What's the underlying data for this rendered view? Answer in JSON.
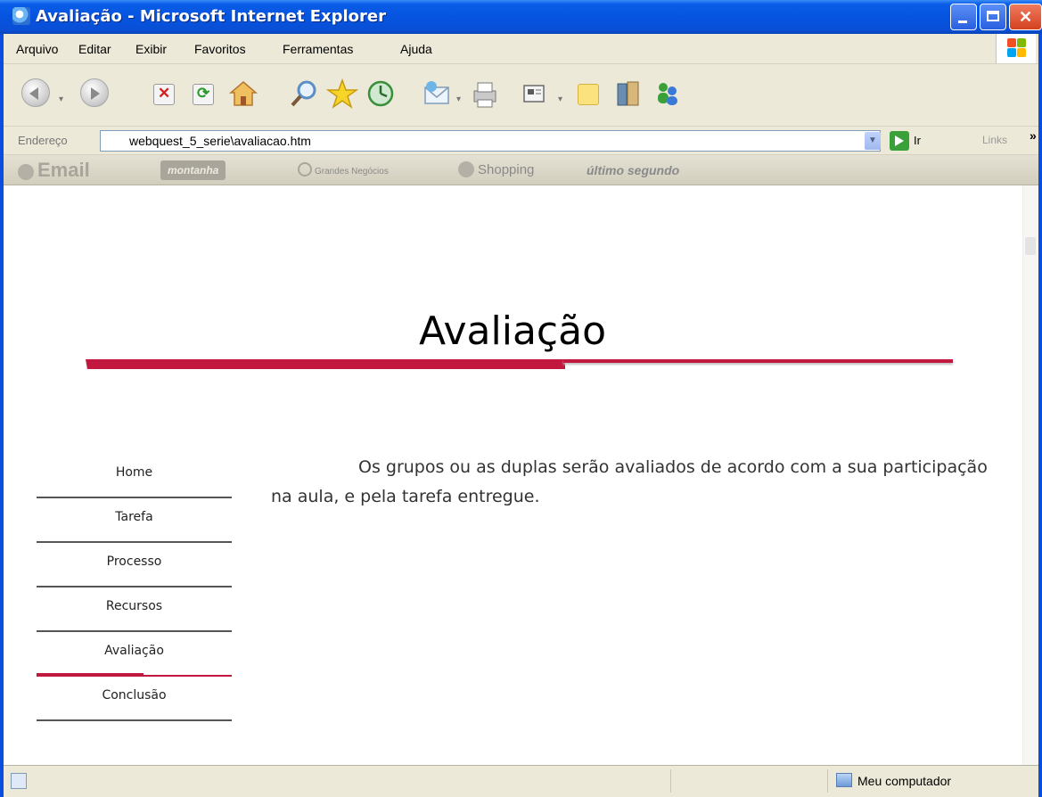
{
  "window": {
    "title": "Avaliação - Microsoft Internet Explorer"
  },
  "menu": {
    "items": [
      "Arquivo",
      "Editar",
      "Exibir",
      "Favoritos",
      "Ferramentas",
      "Ajuda"
    ]
  },
  "address": {
    "label": "Endereço",
    "url": "webquest_5_serie\\avaliacao.htm",
    "go_label": "Ir",
    "links_label": "Links",
    "chevrons": "»"
  },
  "links_bar": {
    "items": [
      "Email",
      "montanha",
      "Grandes Negócios",
      "Shopping",
      "último segundo"
    ]
  },
  "page": {
    "title": "Avaliação",
    "intro": "Os grupos ou as duplas serão avaliados de acordo com a sua participação na aula, e pela tarefa entregue.",
    "nav": [
      {
        "label": "Home"
      },
      {
        "label": "Tarefa"
      },
      {
        "label": "Processo"
      },
      {
        "label": "Recursos"
      },
      {
        "label": "Avaliação",
        "active": true
      },
      {
        "label": "Conclusão"
      }
    ]
  },
  "status": {
    "zone": "Meu computador"
  },
  "colors": {
    "accent": "#c2183f",
    "titlebar": "#0554e0",
    "chrome": "#ece9d8"
  }
}
